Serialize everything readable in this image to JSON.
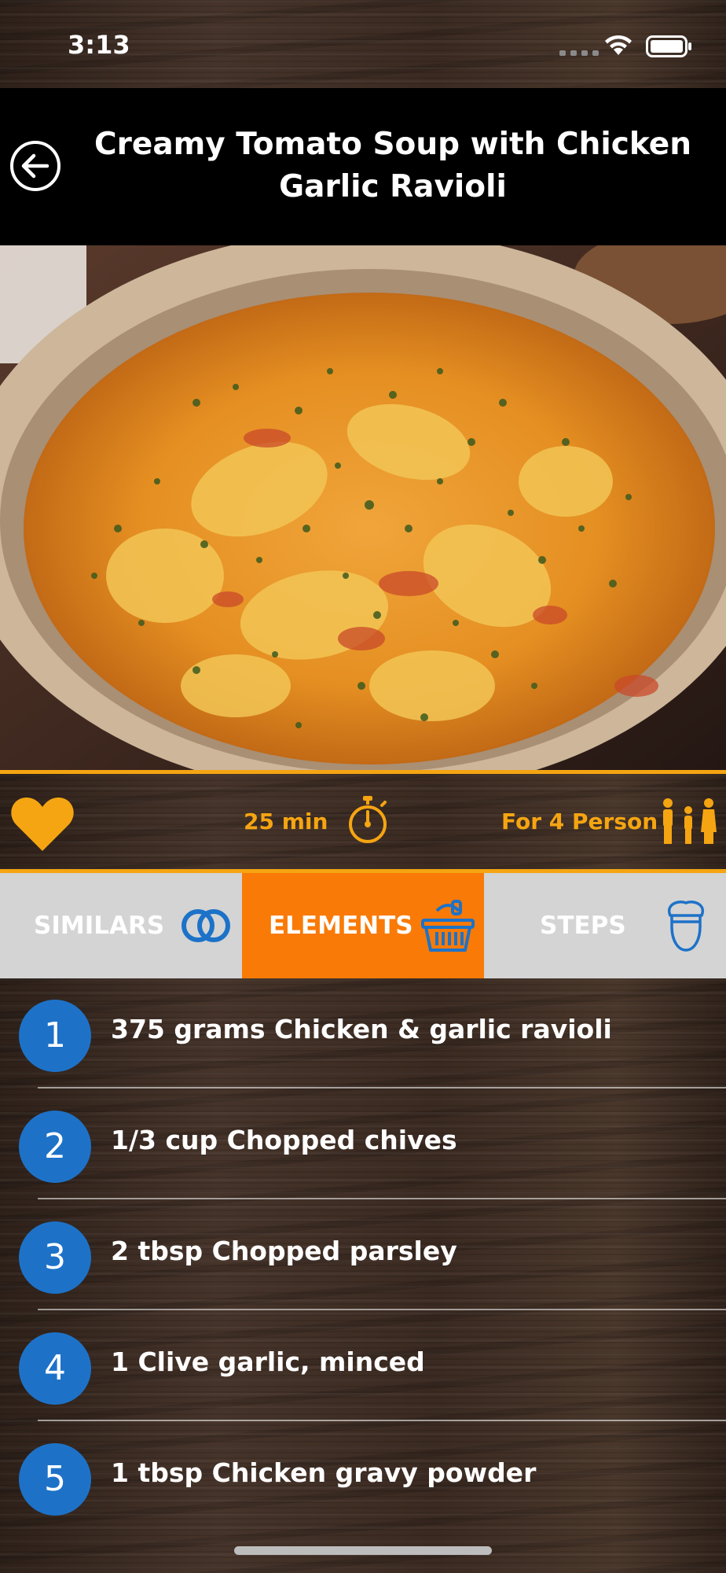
{
  "status": {
    "time": "3:13"
  },
  "header": {
    "title": "Creamy Tomato Soup with Chicken Garlic Ravioli"
  },
  "meta": {
    "duration": "25 min",
    "servings": "For 4 Person"
  },
  "tabs": [
    {
      "label": "SIMILARS",
      "icon": "rings-icon",
      "active": false
    },
    {
      "label": "ELEMENTS",
      "icon": "basket-icon",
      "active": true
    },
    {
      "label": "STEPS",
      "icon": "chef-icon",
      "active": false
    }
  ],
  "ingredients": [
    {
      "num": "1",
      "text": "375 grams Chicken & garlic ravioli"
    },
    {
      "num": "2",
      "text": "1/3 cup Chopped chives"
    },
    {
      "num": "3",
      "text": "2 tbsp Chopped parsley"
    },
    {
      "num": "4",
      "text": "1 Clive garlic, minced"
    },
    {
      "num": "5",
      "text": "1 tbsp Chicken gravy powder"
    }
  ],
  "colors": {
    "accent": "#f5a512",
    "active_tab": "#f97a06",
    "number_badge": "#1d72c8",
    "header_bg": "#000000"
  }
}
